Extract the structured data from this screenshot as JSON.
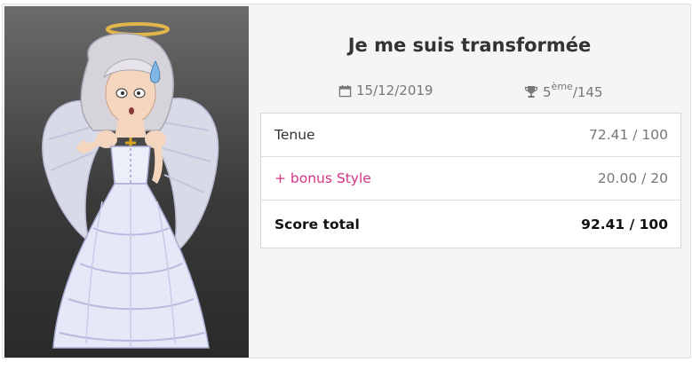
{
  "look": {
    "title": "Je me suis transformée",
    "date": "15/12/2019",
    "rank": {
      "position": "5",
      "suffix": "ème",
      "total": "/145"
    }
  },
  "scores": [
    {
      "label": "Tenue",
      "value": "72.41 / 100"
    },
    {
      "label": "+ bonus Style",
      "value": "20.00 / 20"
    },
    {
      "label": "Score total",
      "value": "92.41 / 100"
    }
  ],
  "colors": {
    "bonus_label": "#d63384",
    "panel_top": "#6b6b6b",
    "panel_bottom": "#2a2a2a"
  },
  "icons": {
    "date": "calendar-icon",
    "rank": "trophy-icon"
  }
}
